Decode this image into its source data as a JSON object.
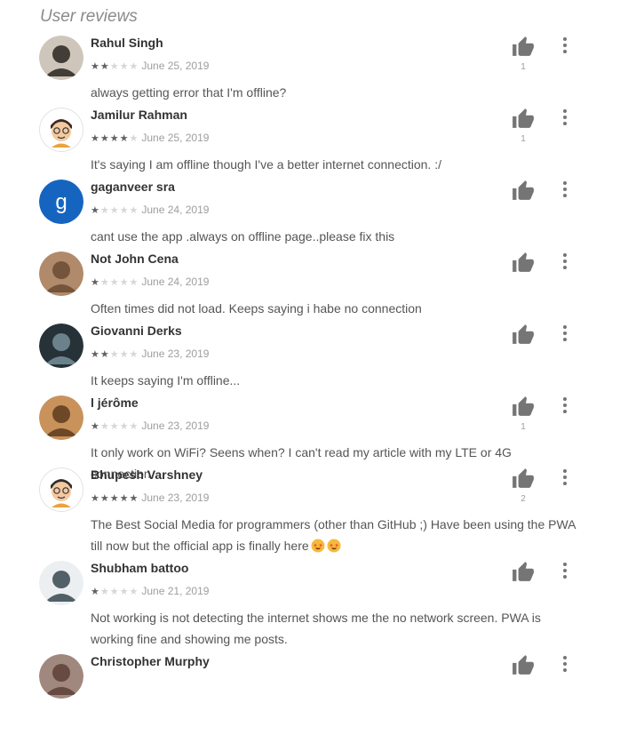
{
  "section": {
    "title": "User reviews"
  },
  "colors": {
    "star_filled": "#616161",
    "star_empty": "#d6d6d6",
    "icon": "#757575"
  },
  "icons": {
    "helpful": "thumb-up-icon",
    "more": "more-vert-icon",
    "star": "star-icon"
  },
  "reviews": [
    {
      "author": "Rahul Singh",
      "rating": 2,
      "date": "June 25, 2019",
      "text": "always getting error that I'm offline?",
      "helpful_count": "1",
      "avatar": "photo"
    },
    {
      "author": "Jamilur Rahman",
      "rating": 4,
      "date": "June 25, 2019",
      "text": "It's saying I am offline though I've a better internet connection. :/",
      "helpful_count": "1",
      "avatar": "cartoon"
    },
    {
      "author": "gaganveer sra",
      "rating": 1,
      "date": "June 24, 2019",
      "text": "cant use the app .always on offline page..please fix this",
      "helpful_count": "",
      "avatar": "letter",
      "avatar_letter": "g"
    },
    {
      "author": "Not John Cena",
      "rating": 1,
      "date": "June 24, 2019",
      "text": "Often times did not load. Keeps saying i habe no connection",
      "helpful_count": "",
      "avatar": "photo"
    },
    {
      "author": "Giovanni Derks",
      "rating": 2,
      "date": "June 23, 2019",
      "text": "It keeps saying I'm offline...",
      "helpful_count": "",
      "avatar": "photo"
    },
    {
      "author": "l jérôme",
      "rating": 1,
      "date": "June 23, 2019",
      "text": "It only work on WiFi? Seens when? I can't read my article with my LTE or 4G connection...",
      "helpful_count": "1",
      "avatar": "photo"
    },
    {
      "author": "Bhupesh Varshney",
      "rating": 5,
      "date": "June 23, 2019",
      "text": "The Best Social Media for programmers (other than GitHub ;) Have been using the PWA till now but the official app is finally here",
      "helpful_count": "2",
      "avatar": "cartoon"
    },
    {
      "author": "Shubham battoo",
      "rating": 1,
      "date": "June 21, 2019",
      "text": "Not working is not detecting the internet shows me the no network screen. PWA is working fine and showing me posts.",
      "helpful_count": "",
      "avatar": "photo"
    },
    {
      "author": "Christopher Murphy",
      "rating": 0,
      "date": "",
      "text": "",
      "helpful_count": "",
      "avatar": "photo"
    }
  ]
}
